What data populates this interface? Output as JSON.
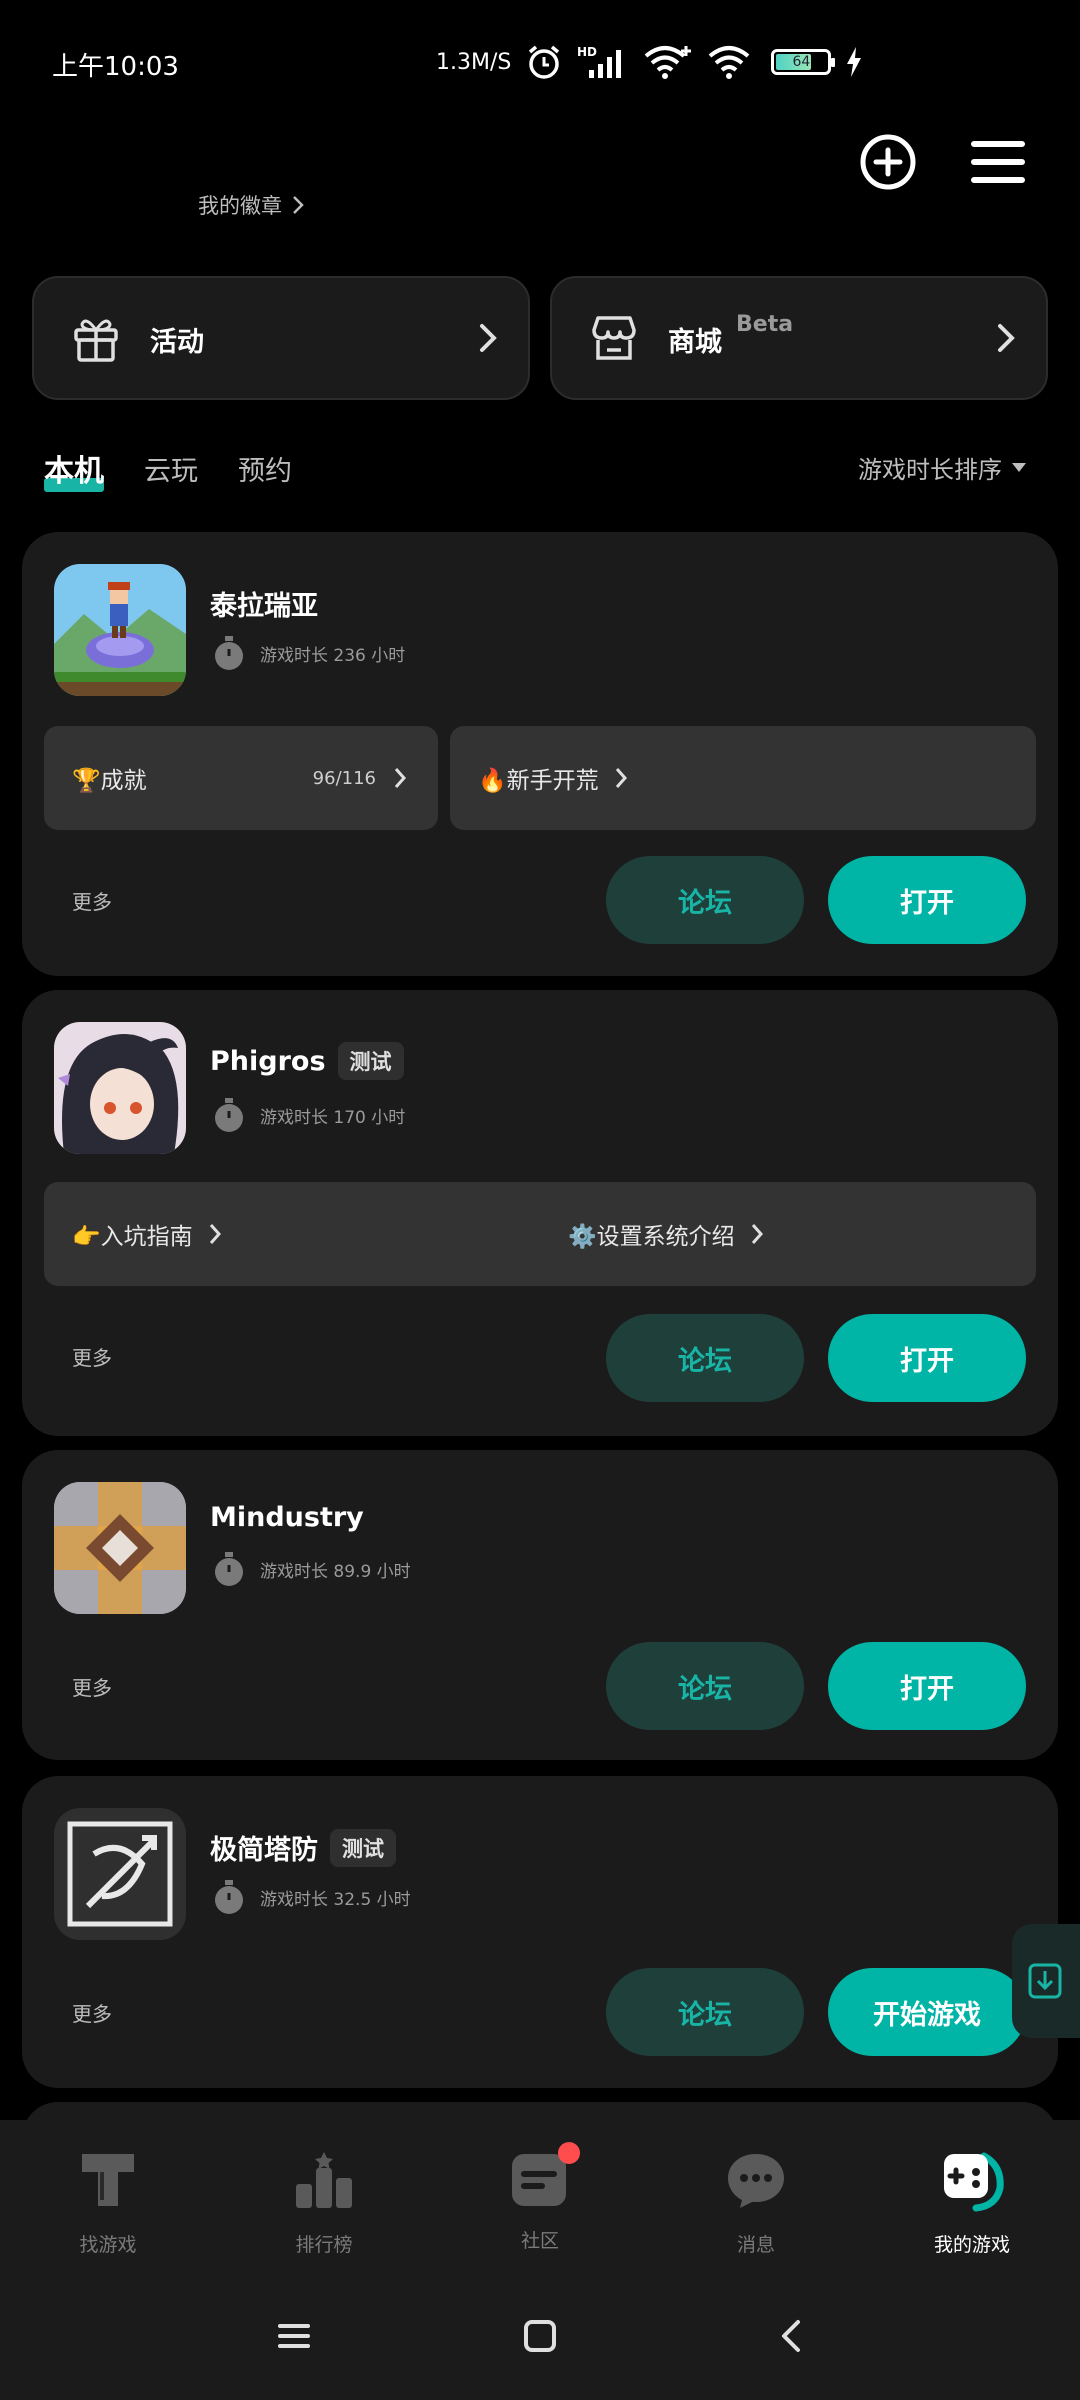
{
  "status_bar": {
    "time": "上午10:03",
    "net_speed": "1.3M/S",
    "battery_level": "64"
  },
  "header": {
    "badge_link": "我的徽章"
  },
  "actions": [
    {
      "label": "活动",
      "tag": ""
    },
    {
      "label": "商城",
      "tag": "Beta"
    }
  ],
  "tabs": [
    "本机",
    "云玩",
    "预约"
  ],
  "sort_label": "游戏时长排序",
  "games": [
    {
      "name": "泰拉瑞亚",
      "tag": "",
      "play_time": "游戏时长 236 小时",
      "sub": [
        {
          "label": "🏆成就",
          "count": "96/116"
        },
        {
          "label": "🔥新手开荒",
          "count": ""
        }
      ],
      "more": "更多",
      "forum": "论坛",
      "open": "打开"
    },
    {
      "name": "Phigros",
      "tag": "测试",
      "play_time": "游戏时长 170 小时",
      "sub": [
        {
          "label": "👉入坑指南",
          "count": ""
        },
        {
          "label": "⚙️设置系统介绍",
          "count": ""
        }
      ],
      "more": "更多",
      "forum": "论坛",
      "open": "打开"
    },
    {
      "name": "Mindustry",
      "tag": "",
      "play_time": "游戏时长 89.9 小时",
      "more": "更多",
      "forum": "论坛",
      "open": "打开"
    },
    {
      "name": "极简塔防",
      "tag": "测试",
      "play_time": "游戏时长 32.5 小时",
      "more": "更多",
      "forum": "论坛",
      "open": "开始游戏"
    }
  ],
  "bottom_nav": [
    {
      "label": "找游戏",
      "icon": "find-game-icon"
    },
    {
      "label": "排行榜",
      "icon": "ranking-icon"
    },
    {
      "label": "社区",
      "icon": "community-icon"
    },
    {
      "label": "消息",
      "icon": "message-icon"
    },
    {
      "label": "我的游戏",
      "icon": "my-games-icon"
    }
  ],
  "colors": {
    "accent": "#00b4a6",
    "forum_bg": "#1f3f3b",
    "card_bg": "#1b1b1b"
  }
}
